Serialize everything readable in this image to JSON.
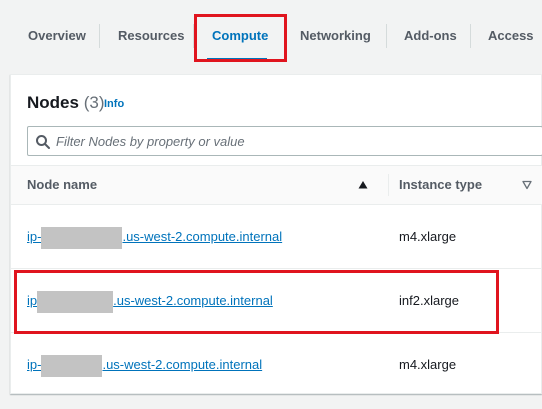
{
  "tabs": [
    {
      "label": "Overview"
    },
    {
      "label": "Resources"
    },
    {
      "label": "Compute",
      "active": true
    },
    {
      "label": "Networking"
    },
    {
      "label": "Add-ons"
    },
    {
      "label": "Access"
    }
  ],
  "nodes_panel": {
    "title": "Nodes",
    "count": "(3)",
    "info_label": "Info",
    "filter_placeholder": "Filter Nodes by property or value",
    "columns": {
      "node_name": "Node name",
      "instance_type": "Instance type"
    },
    "rows": [
      {
        "name_prefix": "ip-",
        "name_suffix": ".us-west-2.compute.internal",
        "instance_type": "m4.xlarge"
      },
      {
        "name_prefix": "ip",
        "name_suffix": ".us-west-2.compute.internal",
        "instance_type": "inf2.xlarge"
      },
      {
        "name_prefix": "ip-",
        "name_suffix": ".us-west-2.compute.internal",
        "instance_type": "m4.xlarge"
      }
    ]
  },
  "icons": {
    "filter": "search-icon",
    "sort_active": "caret-up-filled-icon",
    "sort_inactive": "caret-down-outline-icon"
  },
  "colors": {
    "accent": "#0073bb",
    "highlight": "#e0141e",
    "redaction": "#c3c3c3"
  }
}
